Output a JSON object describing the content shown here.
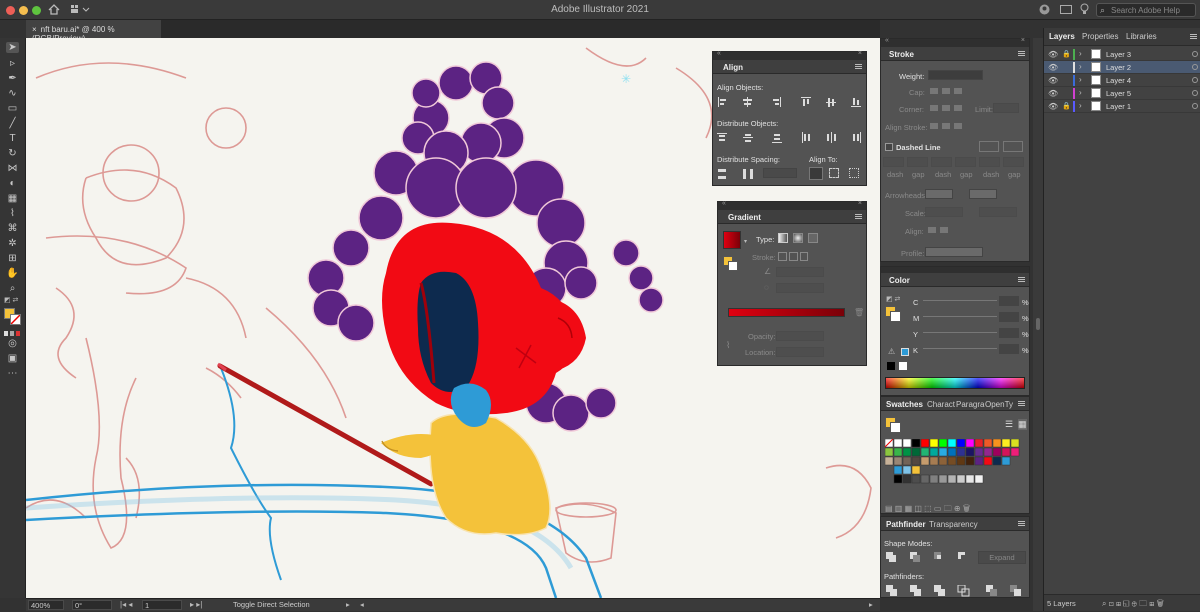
{
  "app": {
    "title": "Adobe Illustrator 2021",
    "search_placeholder": "Search Adobe Help"
  },
  "document": {
    "tab_label": "nft baru.ai* @ 400 % (RGB/Preview)",
    "close_glyph": "×"
  },
  "status": {
    "zoom": "400%",
    "rotation": "0°",
    "artboard": "1",
    "tool_hint": "Toggle Direct Selection"
  },
  "align_panel": {
    "title": "Align",
    "align_objects": "Align Objects:",
    "distribute_objects": "Distribute Objects:",
    "distribute_spacing": "Distribute Spacing:",
    "align_to": "Align To:"
  },
  "gradient_panel": {
    "title": "Gradient",
    "type_label": "Type:",
    "stroke_label": "Stroke:",
    "opacity_label": "Opacity:",
    "location_label": "Location:",
    "gradient_start": "#e00010",
    "gradient_end": "#7a0008"
  },
  "stroke_panel": {
    "title": "Stroke",
    "weight": "Weight:",
    "cap": "Cap:",
    "corner": "Corner:",
    "limit": "Limit:",
    "align_stroke": "Align Stroke:",
    "dashed_line": "Dashed Line",
    "dash_labels": [
      "dash",
      "gap",
      "dash",
      "gap",
      "dash",
      "gap"
    ],
    "arrowheads": "Arrowheads:",
    "scale": "Scale:",
    "align": "Align:",
    "profile": "Profile:"
  },
  "color_panel": {
    "title": "Color",
    "channels": [
      "C",
      "M",
      "Y",
      "K"
    ],
    "percent": "%"
  },
  "swatches_panel": {
    "tabs": [
      "Swatches",
      "Charact",
      "Paragra",
      "OpenTy"
    ]
  },
  "pathfinder_panel": {
    "tabs": [
      "Pathfinder",
      "Transparency"
    ],
    "shape_modes": "Shape Modes:",
    "pathfinders": "Pathfinders:",
    "expand": "Expand"
  },
  "right_dock": {
    "tabs": [
      "Layers",
      "Properties",
      "Libraries"
    ],
    "layers": [
      {
        "name": "Layer 3",
        "color": "#4caf50",
        "locked": true,
        "selected": false
      },
      {
        "name": "Layer 2",
        "color": "#e0e0e0",
        "locked": false,
        "selected": true
      },
      {
        "name": "Layer 4",
        "color": "#3a6cd9",
        "locked": false,
        "selected": false
      },
      {
        "name": "Layer 5",
        "color": "#d040d0",
        "locked": false,
        "selected": false
      },
      {
        "name": "Layer 1",
        "color": "#5a5aff",
        "locked": true,
        "selected": false
      }
    ],
    "layer_count": "5 Layers"
  },
  "artwork_colors": {
    "hair": "#5c2383",
    "face": "#f20a14",
    "mouth": "#0d2a4e",
    "body": "#f4c23a",
    "rod": "#b01a1a",
    "line": "#2e9bd6",
    "sketch": "#d98a86"
  }
}
